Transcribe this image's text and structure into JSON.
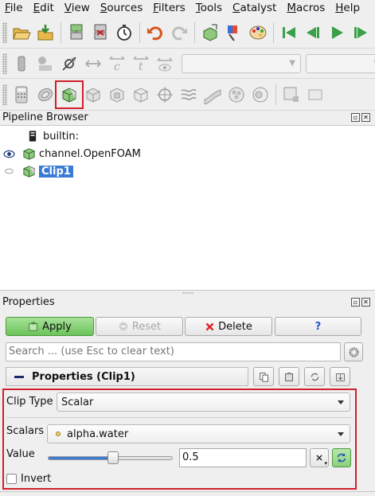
{
  "menubar": {
    "items": [
      {
        "label": "File",
        "mnemonic": "F",
        "rest": "ile"
      },
      {
        "label": "Edit",
        "mnemonic": "E",
        "rest": "dit"
      },
      {
        "label": "View",
        "mnemonic": "V",
        "rest": "iew"
      },
      {
        "label": "Sources",
        "mnemonic": "S",
        "rest": "ources"
      },
      {
        "label": "Filters",
        "mnemonic": "F",
        "rest": "ilters"
      },
      {
        "label": "Tools",
        "mnemonic": "T",
        "rest": "ools"
      },
      {
        "label": "Catalyst",
        "mnemonic": "C",
        "rest": "atalyst"
      },
      {
        "label": "Macros",
        "mnemonic": "M",
        "rest": "acros"
      },
      {
        "label": "Help",
        "mnemonic": "H",
        "rest": "elp"
      }
    ]
  },
  "pipeline_browser": {
    "title": "Pipeline Browser",
    "items": [
      {
        "label": "builtin:",
        "icon": "server-icon"
      },
      {
        "label": "channel.OpenFOAM",
        "icon": "cube-source-icon",
        "visible": true
      },
      {
        "label": "Clip1",
        "icon": "clip-filter-icon",
        "selected": true,
        "visible": false
      }
    ]
  },
  "properties": {
    "title": "Properties",
    "apply_label": "Apply",
    "reset_label": "Reset",
    "delete_label": "Delete",
    "help_label": "?",
    "search_placeholder": "Search ... (use Esc to clear text)",
    "section_title": "Properties (Clip1)",
    "clip_type_label": "Clip Type",
    "clip_type_value": "Scalar",
    "scalars_label": "Scalars",
    "scalars_value": "alpha.water",
    "value_label": "Value",
    "value": "0.5",
    "slider_fraction": 0.52,
    "invert_label": "Invert",
    "invert_checked": false
  },
  "colors": {
    "highlight": "#d0202a",
    "selection": "#3a7bd5",
    "apply": "#6cc35a"
  }
}
